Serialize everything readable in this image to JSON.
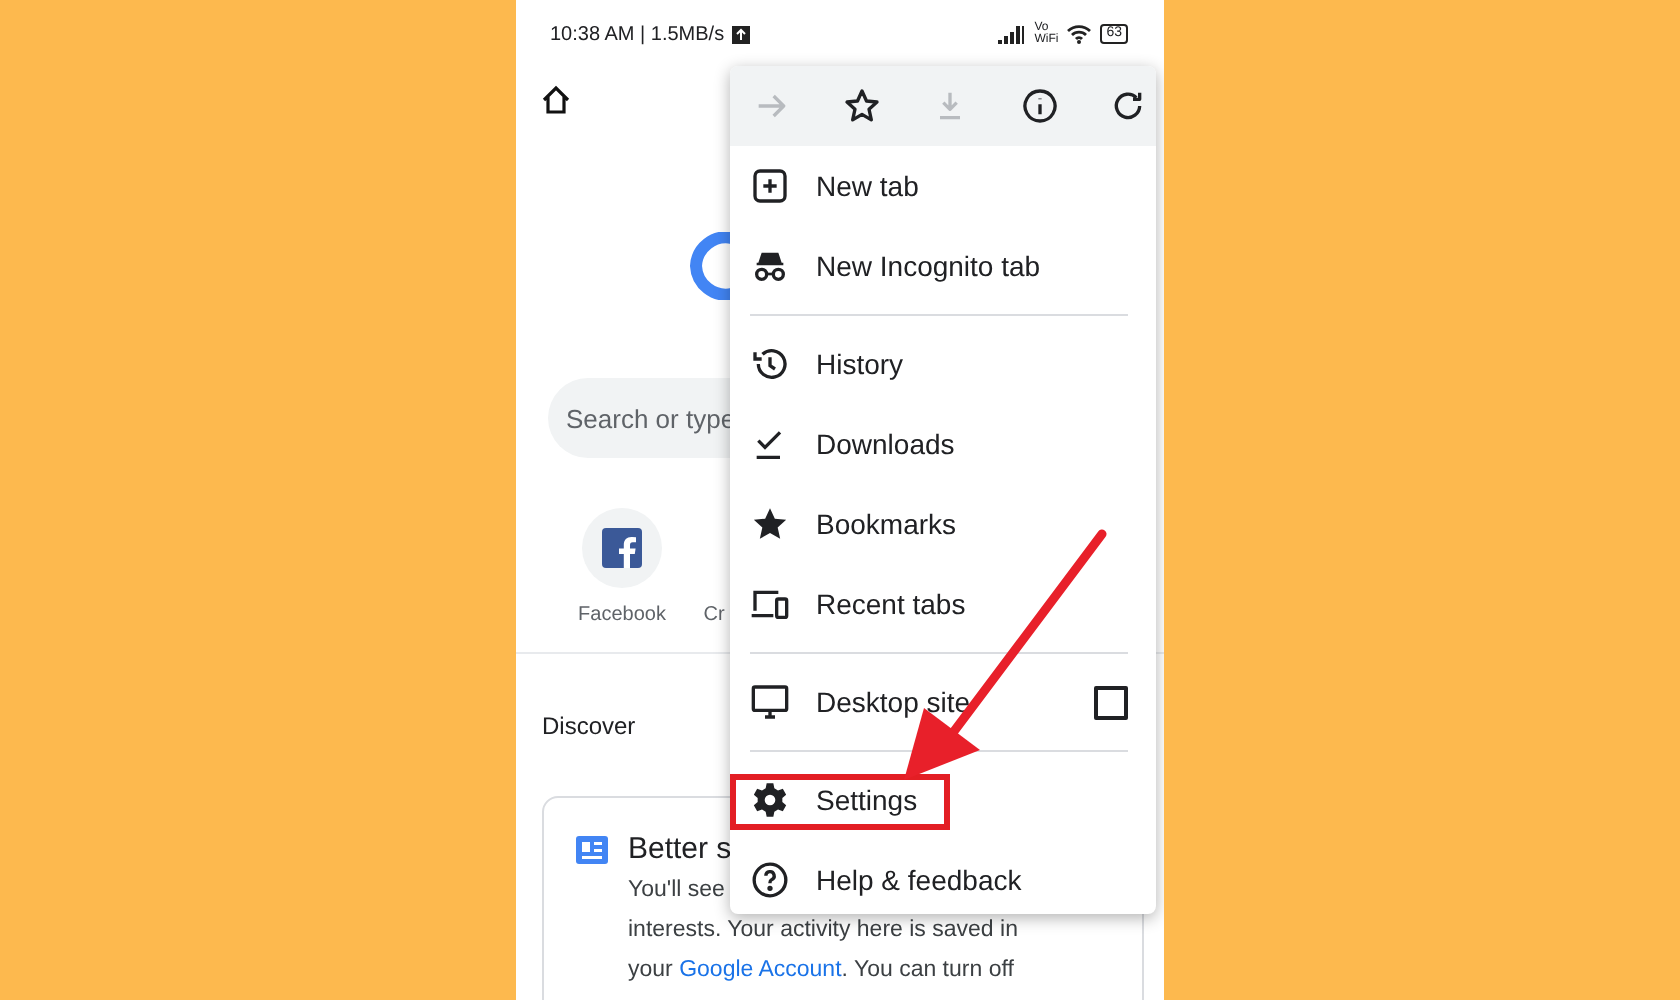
{
  "status_bar": {
    "time": "10:38 AM | 1.5MB/s",
    "wifi_label_top": "Vo",
    "wifi_label_bottom": "WiFi",
    "battery": "63"
  },
  "page": {
    "search": {
      "placeholder": "Search or type"
    },
    "shortcuts": [
      {
        "label": "Facebook",
        "kind": "facebook"
      },
      {
        "label": "Cr",
        "kind": "blank"
      }
    ],
    "discover": "Discover",
    "card": {
      "title": "Better s",
      "lines": [
        "You'll see",
        "interests. Your activity here is saved in"
      ],
      "last_line": {
        "before": "your ",
        "link": "Google Account",
        "after": ". You can turn off"
      }
    }
  },
  "menu": {
    "toolbar": [
      {
        "kind": "forward",
        "disabled": true
      },
      {
        "kind": "star",
        "disabled": false
      },
      {
        "kind": "download",
        "disabled": true
      },
      {
        "kind": "info",
        "disabled": false
      },
      {
        "kind": "refresh",
        "disabled": false
      }
    ],
    "items": [
      {
        "kind": "item",
        "label": "New tab",
        "highlighted": false
      },
      {
        "kind": "item",
        "label": "New Incognito tab",
        "highlighted": false
      },
      {
        "kind": "divider"
      },
      {
        "kind": "item",
        "label": "History",
        "highlighted": false
      },
      {
        "kind": "item",
        "label": "Downloads",
        "highlighted": false
      },
      {
        "kind": "item",
        "label": "Bookmarks",
        "highlighted": false
      },
      {
        "kind": "item",
        "label": "Recent tabs",
        "highlighted": false
      },
      {
        "kind": "divider"
      },
      {
        "kind": "checkbox",
        "label": "Desktop site",
        "checked": false,
        "highlighted": false
      },
      {
        "kind": "divider"
      },
      {
        "kind": "item",
        "label": "Settings",
        "highlighted": true
      },
      {
        "kind": "item",
        "label": "Help & feedback",
        "highlighted": false
      }
    ]
  },
  "annotation": {
    "arrow": true
  }
}
